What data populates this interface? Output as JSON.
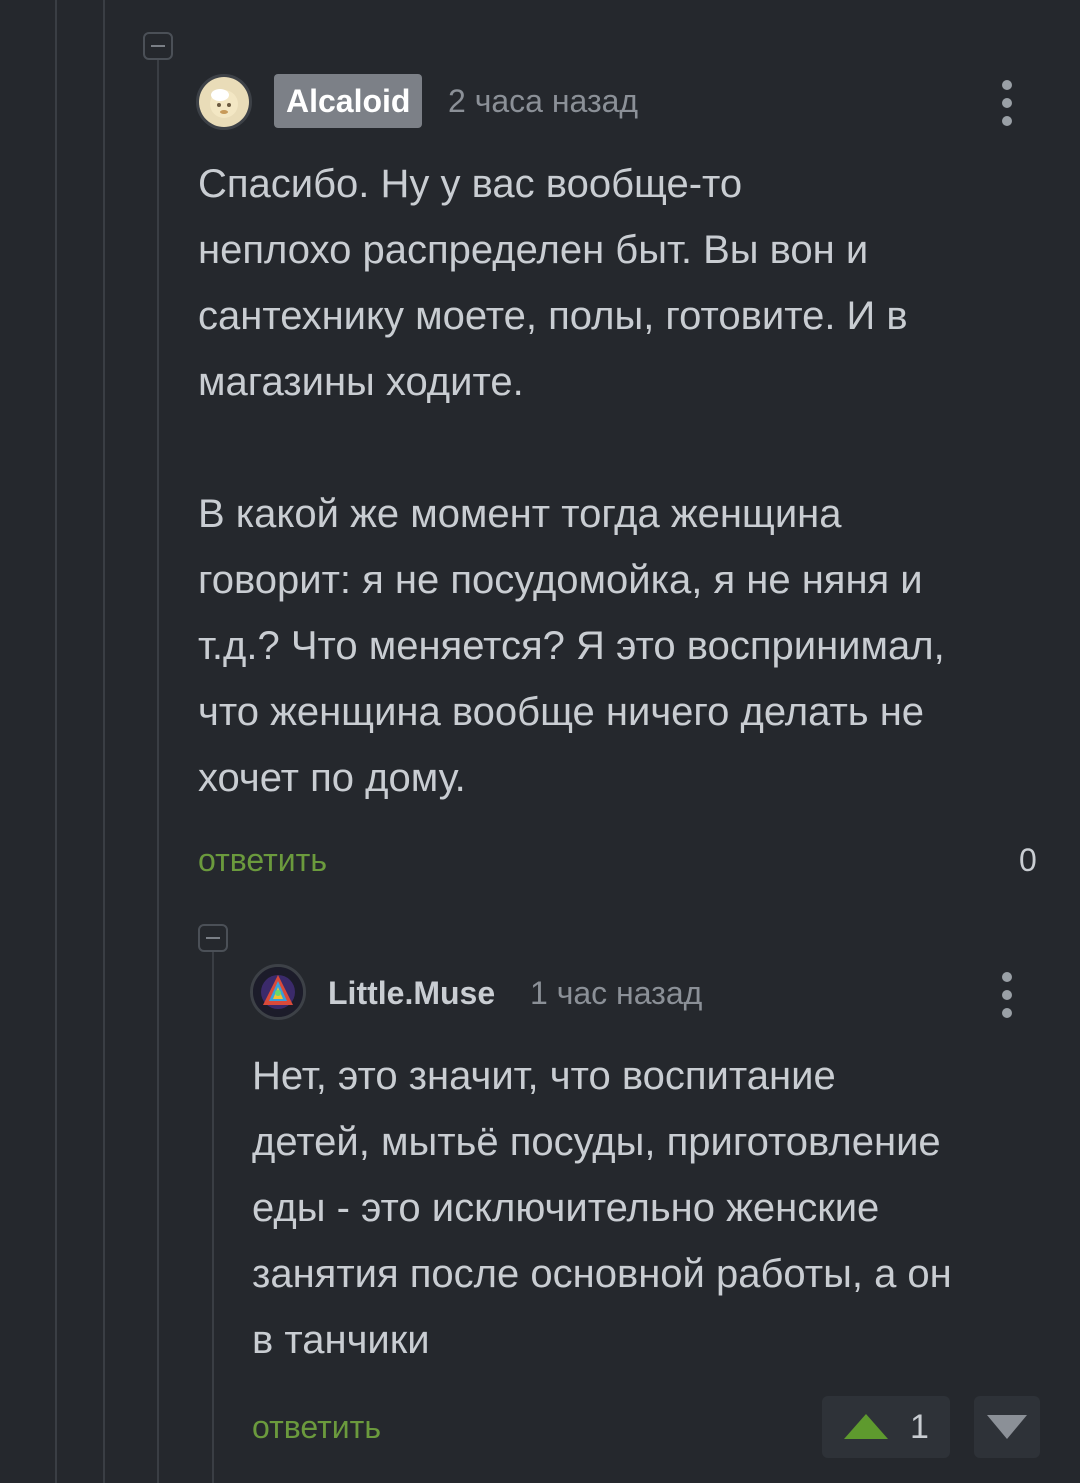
{
  "comments": [
    {
      "author": "Alcaloid",
      "time": "2 часа назад",
      "text": "Спасибо. Ну у вас вообще-то\nнеплохо распределен быт. Вы вон и\nсантехнику моете, полы, готовите. И в\nмагазины ходите.\n\nВ какой же момент тогда женщина\nговорит: я не посудомойка, я не няня и\nт.д.? Что меняется? Я это воспринимал,\nчто женщина вообще ничего делать не\nхочет по дому.",
      "reply_label": "ответить",
      "rating": "0"
    },
    {
      "author": "Little.Muse",
      "time": "1 час назад",
      "text": "Нет, это значит, что воспитание\nдетей, мытьё посуды, приготовление\nеды - это исключительно женские\nзанятия после основной работы, а он\nв танчики",
      "reply_label": "ответить",
      "rating": "1"
    }
  ],
  "colors": {
    "background": "#25282d",
    "text": "#c9cdd2",
    "muted": "#8b9097",
    "reply_link": "#6b9a3d",
    "vote_up": "#5e9a2e",
    "badge": "#7c8087"
  },
  "icons": {
    "collapse": "minus-box-icon",
    "more": "vertical-dots-icon",
    "upvote": "triangle-up-icon",
    "downvote": "triangle-down-icon"
  }
}
